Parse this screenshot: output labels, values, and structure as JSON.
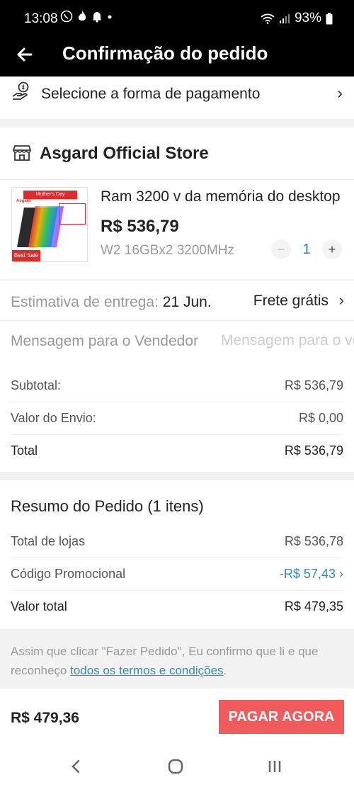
{
  "status_bar": {
    "time": "13:08",
    "battery": "93%"
  },
  "header": {
    "title": "Confirmação do pedido"
  },
  "payment": {
    "label": "Selecione a forma de pagamento"
  },
  "store": {
    "name": "Asgard Official Store",
    "product": {
      "name": "Ram 3200 v da memória do desktop",
      "price": "R$ 536,79",
      "variant": "W2 16GBx2 3200MHz",
      "quantity": "1",
      "image_text": {
        "banner": "Mother's Day",
        "brand": "Asgard",
        "badge": "Best Sale"
      }
    },
    "delivery": {
      "label": "Estimativa de entrega:",
      "date": "21 Jun.",
      "shipping": "Frete grátis"
    },
    "message": {
      "label": "Mensagem para o Vendedor",
      "placeholder": "Mensagem para o vendedor"
    },
    "summary": [
      {
        "label": "Subtotal:",
        "value": "R$ 536,79"
      },
      {
        "label": "Valor do Envio:",
        "value": "R$ 0,00"
      },
      {
        "label": "Total",
        "value": "R$ 536,79"
      }
    ]
  },
  "order_summary": {
    "title": "Resumo do Pedido (1 itens)",
    "rows": [
      {
        "label": "Total de lojas",
        "value": "R$ 536,78"
      },
      {
        "label": "Código Promocional",
        "value": "-R$ 57,43"
      },
      {
        "label": "Valor total",
        "value": "R$ 479,35"
      }
    ]
  },
  "terms": {
    "text_before": "Assim que clicar \"Fazer Pedido\", Eu confirmo que li e que reconheço ",
    "link": "todos os termos e condições",
    "text_after": "."
  },
  "checkout": {
    "total": "R$ 479,36",
    "pay_button": "PAGAR AGORA"
  },
  "colors": {
    "accent_red": "#f25b5b",
    "link_blue": "#2a8fbf",
    "header_bg": "#000000"
  },
  "icons": {
    "payment": "hand-coin-icon",
    "store": "storefront-icon",
    "back": "arrow-left-icon"
  }
}
